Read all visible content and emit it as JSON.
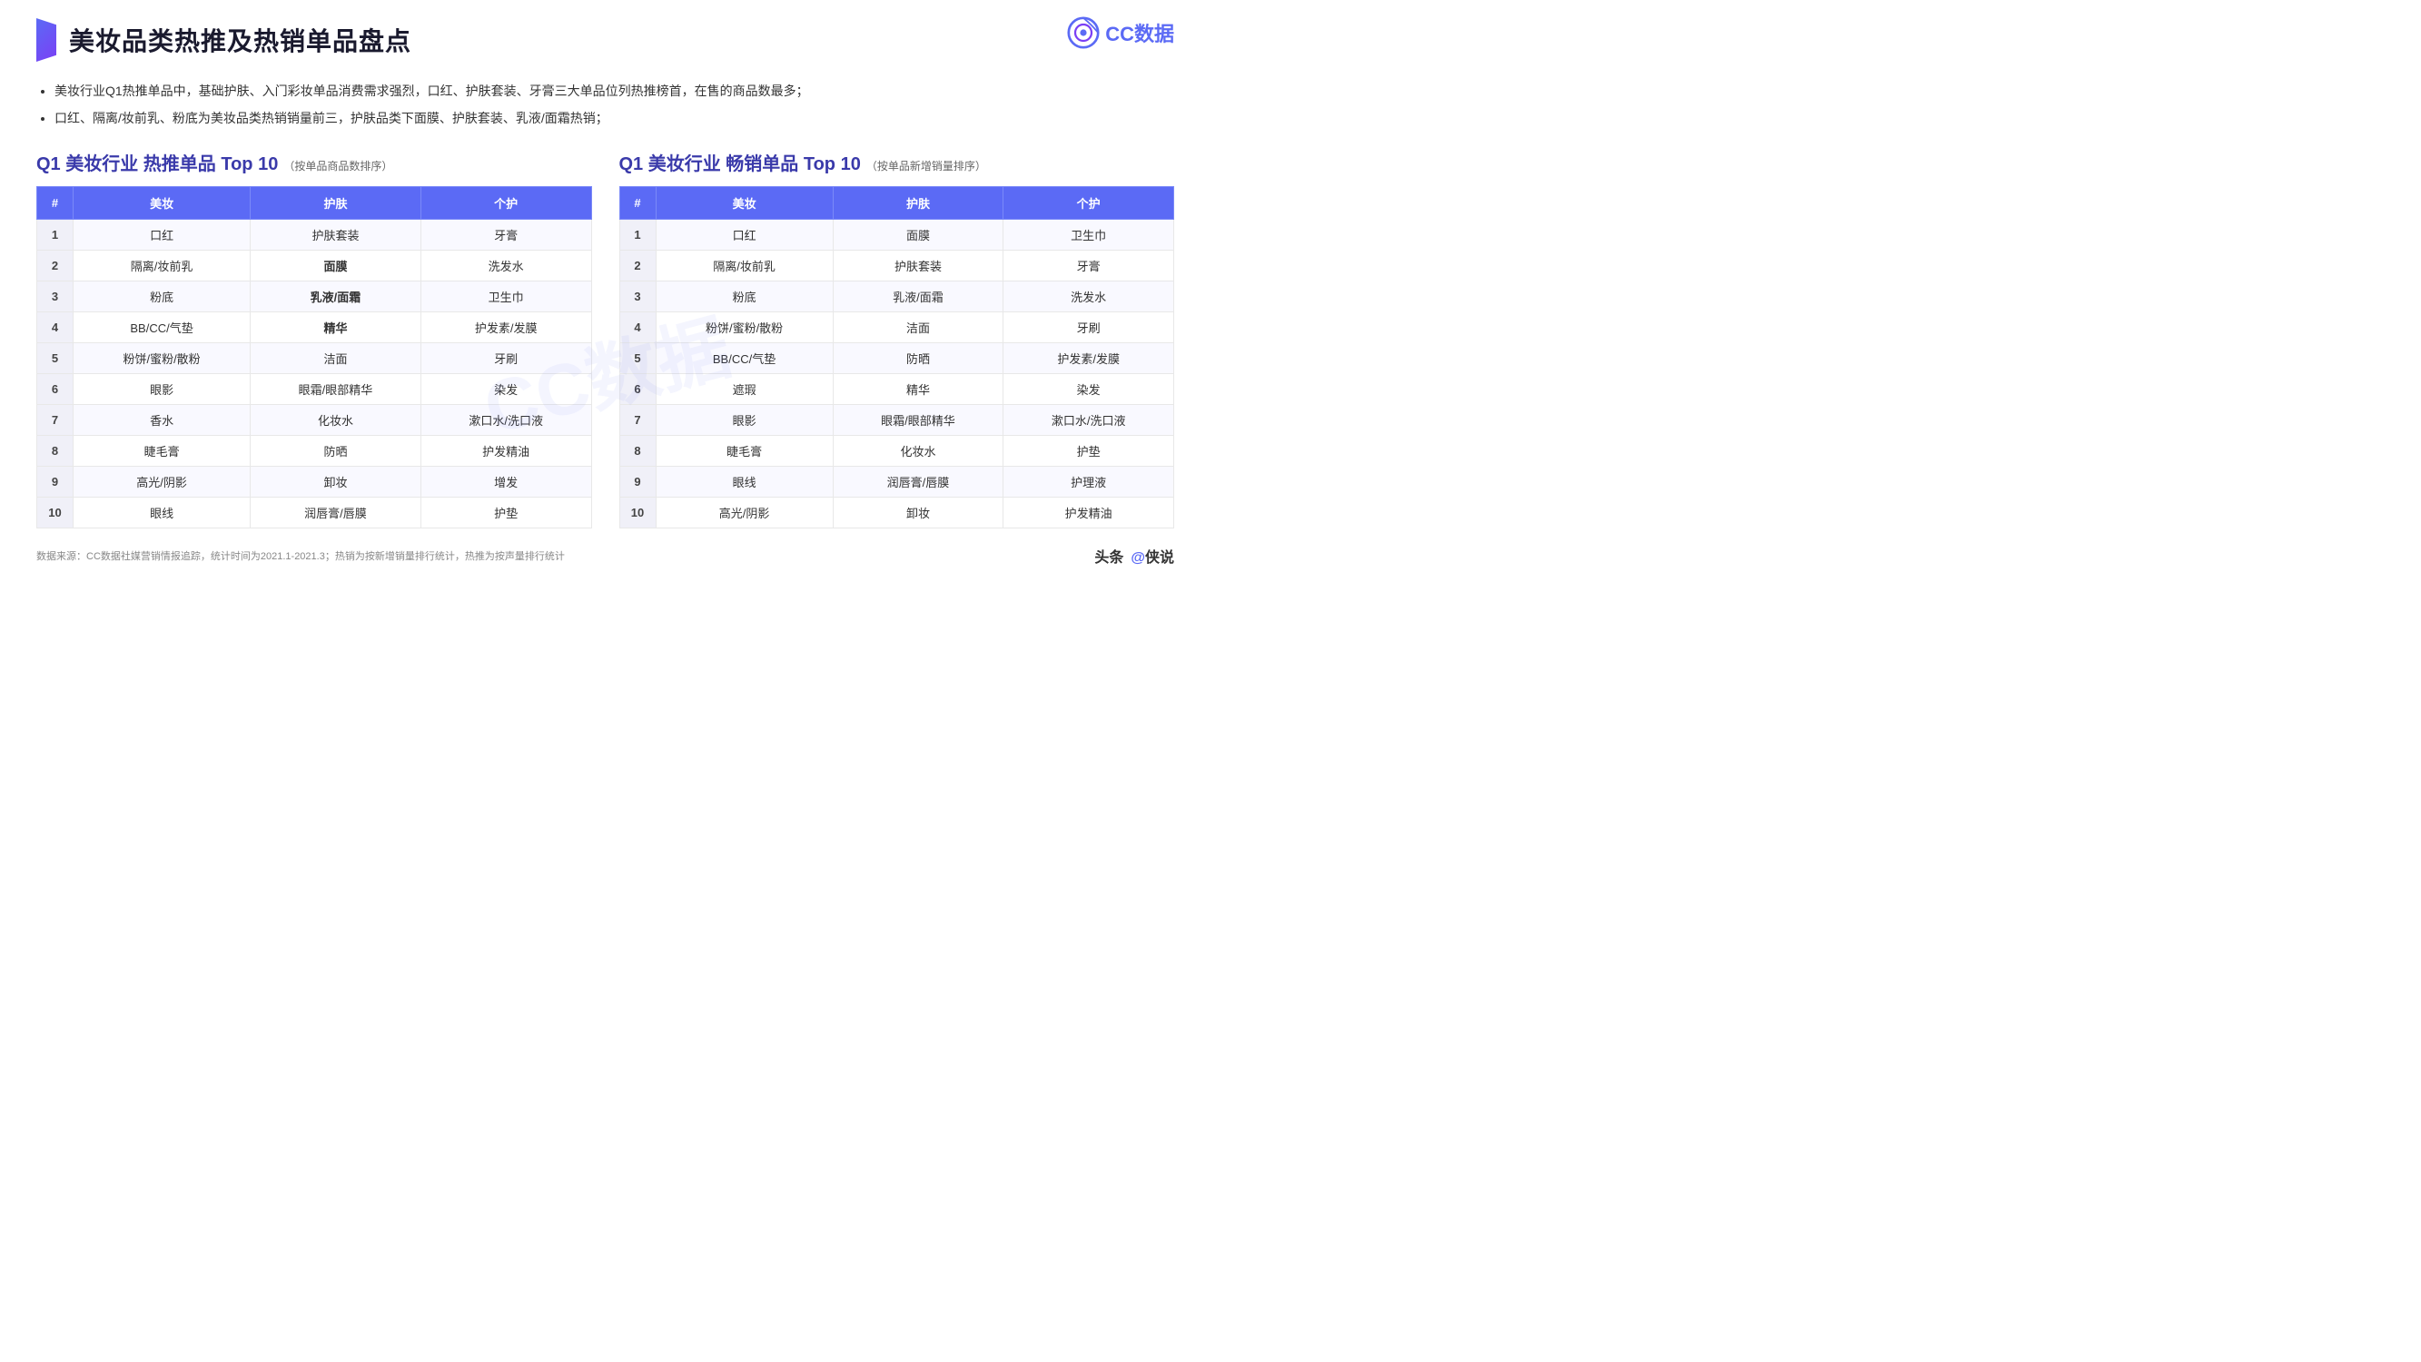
{
  "logo": {
    "text": "CC数据",
    "icon": "CC"
  },
  "header": {
    "title": "美妆品类热推及热销单品盘点"
  },
  "bullets": [
    "美妆行业Q1热推单品中，基础护肤、入门彩妆单品消费需求强烈，口红、护肤套装、牙膏三大单品位列热推榜首，在售的商品数最多；",
    "口红、隔离/妆前乳、粉底为美妆品类热销销量前三，护肤品类下面膜、护肤套装、乳液/面霜热销；"
  ],
  "left_table": {
    "title": "Q1 美妆行业 热推单品 Top 10",
    "subtitle": "（按单品商品数排序）",
    "headers": [
      "#",
      "美妆",
      "护肤",
      "个护"
    ],
    "rows": [
      {
        "rank": "1",
        "col1": "口红",
        "col2": "护肤套装",
        "col3": "牙膏",
        "highlight": []
      },
      {
        "rank": "2",
        "col1": "隔离/妆前乳",
        "col2": "面膜",
        "col3": "洗发水",
        "highlight": [
          "col2"
        ]
      },
      {
        "rank": "3",
        "col1": "粉底",
        "col2": "乳液/面霜",
        "col3": "卫生巾",
        "highlight": [
          "col2"
        ]
      },
      {
        "rank": "4",
        "col1": "BB/CC/气垫",
        "col2": "精华",
        "col3": "护发素/发膜",
        "highlight": [
          "col2"
        ]
      },
      {
        "rank": "5",
        "col1": "粉饼/蜜粉/散粉",
        "col2": "洁面",
        "col3": "牙刷",
        "highlight": []
      },
      {
        "rank": "6",
        "col1": "眼影",
        "col2": "眼霜/眼部精华",
        "col3": "染发",
        "highlight": []
      },
      {
        "rank": "7",
        "col1": "香水",
        "col2": "化妆水",
        "col3": "漱口水/洗口液",
        "highlight": []
      },
      {
        "rank": "8",
        "col1": "睫毛膏",
        "col2": "防晒",
        "col3": "护发精油",
        "highlight": []
      },
      {
        "rank": "9",
        "col1": "高光/阴影",
        "col2": "卸妆",
        "col3": "增发",
        "highlight": []
      },
      {
        "rank": "10",
        "col1": "眼线",
        "col2": "润唇膏/唇膜",
        "col3": "护垫",
        "highlight": []
      }
    ]
  },
  "right_table": {
    "title": "Q1 美妆行业 畅销单品 Top 10",
    "subtitle": "（按单品新增销量排序）",
    "headers": [
      "#",
      "美妆",
      "护肤",
      "个护"
    ],
    "rows": [
      {
        "rank": "1",
        "col1": "口红",
        "col2": "面膜",
        "col3": "卫生巾",
        "highlight": []
      },
      {
        "rank": "2",
        "col1": "隔离/妆前乳",
        "col2": "护肤套装",
        "col3": "牙膏",
        "highlight": []
      },
      {
        "rank": "3",
        "col1": "粉底",
        "col2": "乳液/面霜",
        "col3": "洗发水",
        "highlight": []
      },
      {
        "rank": "4",
        "col1": "粉饼/蜜粉/散粉",
        "col2": "洁面",
        "col3": "牙刷",
        "highlight": []
      },
      {
        "rank": "5",
        "col1": "BB/CC/气垫",
        "col2": "防晒",
        "col3": "护发素/发膜",
        "highlight": []
      },
      {
        "rank": "6",
        "col1": "遮瑕",
        "col2": "精华",
        "col3": "染发",
        "highlight": []
      },
      {
        "rank": "7",
        "col1": "眼影",
        "col2": "眼霜/眼部精华",
        "col3": "漱口水/洗口液",
        "highlight": []
      },
      {
        "rank": "8",
        "col1": "睫毛膏",
        "col2": "化妆水",
        "col3": "护垫",
        "highlight": []
      },
      {
        "rank": "9",
        "col1": "眼线",
        "col2": "润唇膏/唇膜",
        "col3": "护理液",
        "highlight": []
      },
      {
        "rank": "10",
        "col1": "高光/阴影",
        "col2": "卸妆",
        "col3": "护发精油",
        "highlight": []
      }
    ]
  },
  "footer": {
    "note": "数据来源：CC数据社媒营销情报追踪，统计时间为2021.1-2021.3；热销为按新增销量排行统计，热推为按声量排行统计",
    "brand1": "头条",
    "brand2": "@侠说"
  }
}
